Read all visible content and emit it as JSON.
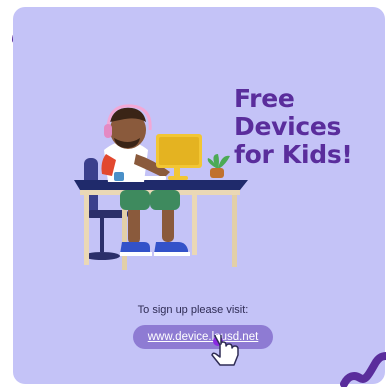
{
  "headline": {
    "line1": "Free",
    "line2": "Devices",
    "line3": "for Kids!"
  },
  "signup": {
    "prompt": "To sign up please visit:",
    "url": "www.device.lausd.net"
  },
  "colors": {
    "background_card": "#c4c3f7",
    "headline": "#5a2d9c",
    "squiggle": "#5a2d9c",
    "url_pill": "#8e7bd3",
    "cursor_dot": "#8a2be2"
  },
  "icons": {
    "illustration": "boy-at-desk-with-computer",
    "pointer": "hand-pointer-icon",
    "decoration": "squiggle"
  }
}
